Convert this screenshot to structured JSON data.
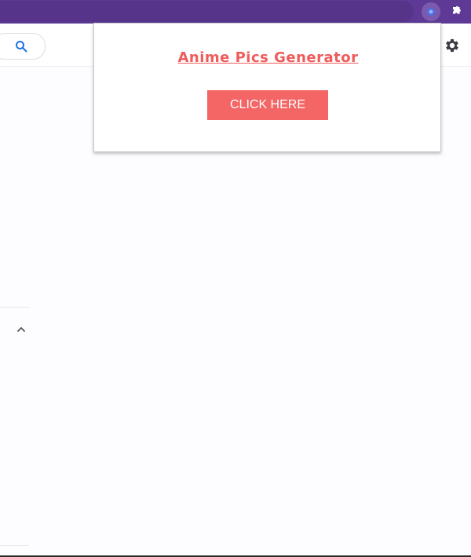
{
  "browser": {
    "accent_color": "#5e3a96",
    "extensions": [
      {
        "name": "anime-pics-extension",
        "icon": "extension-icon"
      },
      {
        "name": "extensions-menu",
        "icon": "puzzle-icon"
      }
    ]
  },
  "page": {
    "search_icon": "search-icon",
    "settings_icon": "gear-icon",
    "collapse_icon": "chevron-up-icon"
  },
  "popup": {
    "title": "Anime Pics Generator",
    "button_label": "CLICK HERE",
    "button_color": "#f46565",
    "title_color": "#ee5c5c"
  }
}
